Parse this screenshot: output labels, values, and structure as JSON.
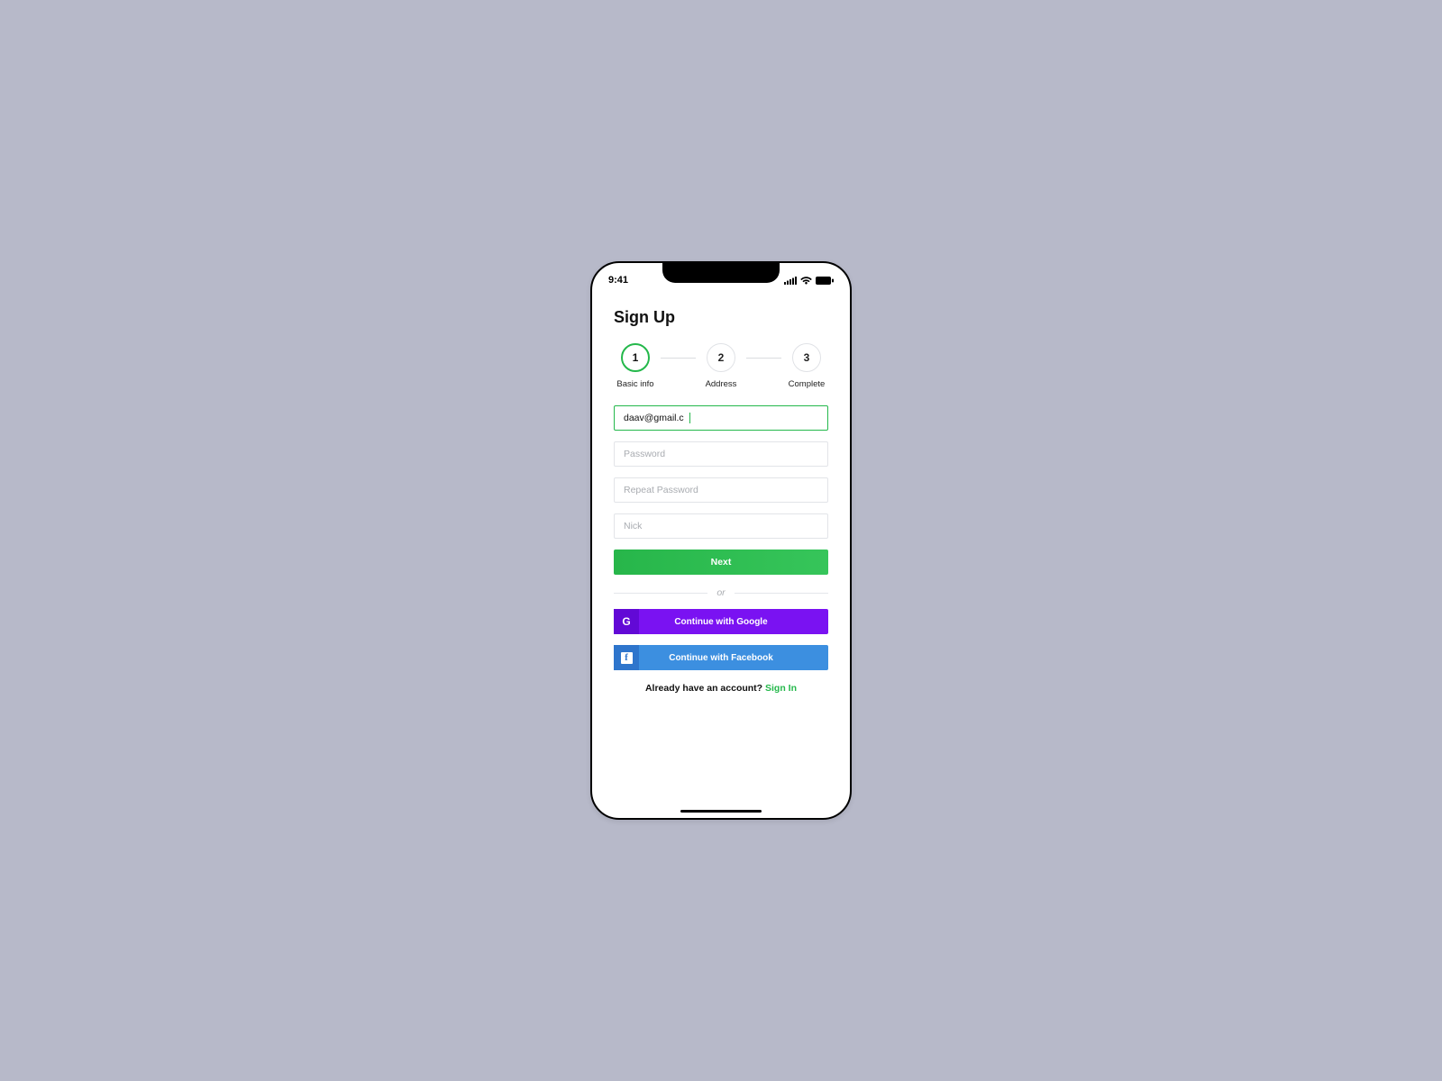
{
  "statusbar": {
    "time": "9:41"
  },
  "title": "Sign Up",
  "steps": [
    {
      "num": "1",
      "label": "Basic info",
      "active": true
    },
    {
      "num": "2",
      "label": "Address",
      "active": false
    },
    {
      "num": "3",
      "label": "Complete",
      "active": false
    }
  ],
  "form": {
    "email_value": "daav@gmail.c",
    "password_ph": "Password",
    "repeat_ph": "Repeat Password",
    "nick_ph": "Nick",
    "next_label": "Next"
  },
  "divider": "or",
  "social": {
    "google_label": "Continue with Google",
    "google_glyph": "G",
    "facebook_label": "Continue with Facebook",
    "facebook_glyph": "f"
  },
  "footer": {
    "prompt": "Already have an account? ",
    "link": "Sign In"
  }
}
